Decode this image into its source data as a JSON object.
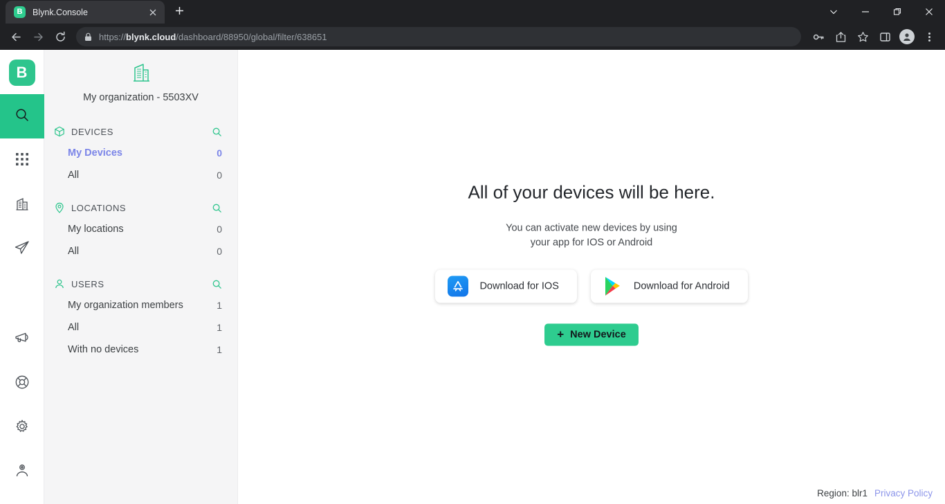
{
  "browser": {
    "tab": {
      "title": "Blynk.Console",
      "favicon_letter": "B",
      "favicon_color": "#2ecc8f",
      "close_icon": "close-icon"
    },
    "new_tab_label": "+",
    "window_controls": [
      "tab-search-icon",
      "minimize-icon",
      "maximize-icon",
      "close-window-icon"
    ],
    "nav": {
      "back": "back-arrow-icon",
      "forward": "forward-arrow-icon",
      "reload": "reload-icon"
    },
    "omnibox": {
      "lock_icon": "lock-icon",
      "scheme": "https://",
      "domain": "blynk.cloud",
      "path": "/dashboard/88950/global/filter/638651",
      "full_url": "https://blynk.cloud/dashboard/88950/global/filter/638651"
    },
    "toolbar_icons": [
      "key-icon",
      "share-icon",
      "bookmark-star-icon",
      "side-panel-icon",
      "profile-avatar-icon",
      "three-dot-menu-icon"
    ]
  },
  "rail": {
    "logo_letter": "B",
    "items": [
      {
        "name": "search-icon",
        "active": true
      },
      {
        "name": "apps-grid-icon",
        "active": false
      },
      {
        "name": "organization-building-icon",
        "active": false
      },
      {
        "name": "paper-plane-icon",
        "active": false
      },
      {
        "name": "megaphone-icon",
        "active": false
      },
      {
        "name": "life-ring-support-icon",
        "active": false
      },
      {
        "name": "gear-settings-icon",
        "active": false
      },
      {
        "name": "user-account-icon",
        "active": false
      }
    ]
  },
  "panel": {
    "organization": {
      "name": "My organization - 5503XV",
      "icon": "building-icon"
    },
    "sections": [
      {
        "title": "DEVICES",
        "icon": "cube-icon",
        "search_icon": "search-icon",
        "rows": [
          {
            "label": "My Devices",
            "count": "0",
            "selected": true
          },
          {
            "label": "All",
            "count": "0",
            "selected": false
          }
        ]
      },
      {
        "title": "LOCATIONS",
        "icon": "map-pin-icon",
        "search_icon": "search-icon",
        "rows": [
          {
            "label": "My locations",
            "count": "0",
            "selected": false
          },
          {
            "label": "All",
            "count": "0",
            "selected": false
          }
        ]
      },
      {
        "title": "USERS",
        "icon": "user-icon",
        "search_icon": "search-icon",
        "rows": [
          {
            "label": "My organization members",
            "count": "1",
            "selected": false
          },
          {
            "label": "All",
            "count": "1",
            "selected": false
          },
          {
            "label": "With no devices",
            "count": "1",
            "selected": false
          }
        ]
      }
    ]
  },
  "main": {
    "empty_title": "All of your devices will be here.",
    "empty_sub_line1": "You can activate new devices by using",
    "empty_sub_line2": "your app for IOS or Android",
    "ios_button": {
      "label": "Download for IOS",
      "icon": "app-store-icon"
    },
    "android_button": {
      "label": "Download for Android",
      "icon": "google-play-icon"
    },
    "new_device_button": {
      "plus": "+",
      "label": "New Device"
    }
  },
  "footer": {
    "region_label": "Region: blr1",
    "privacy_link": "Privacy Policy"
  },
  "colors": {
    "accent_green": "#2ecc8f",
    "rail_active": "#24c48a",
    "selected_blue": "#7b85e8",
    "panel_bg": "#f5f5f6",
    "chrome_bg": "#202124"
  }
}
